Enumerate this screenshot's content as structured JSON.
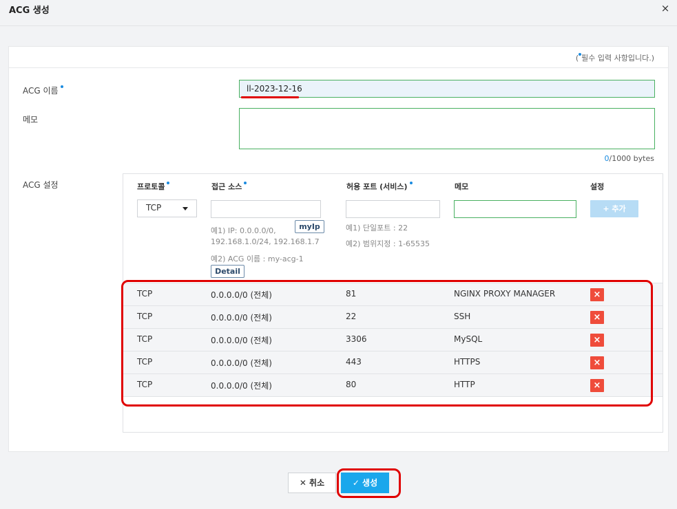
{
  "dialog": {
    "title": "ACG 생성",
    "close_label": "×"
  },
  "form": {
    "required_prefix": "(",
    "required_suffix": "필수 입력 사항입니다.)",
    "name_label": "ACG 이름",
    "name_value": "ll-2023-12-16",
    "memo_label": "메모",
    "memo_value": "",
    "byte_count": "0",
    "byte_limit": "/1000 bytes",
    "acg_setting_label": "ACG 설정"
  },
  "acg_table": {
    "headers": {
      "protocol": "프로토콜",
      "source": "접근 소스",
      "port": "허용 포트 (서비스)",
      "memo": "메모",
      "setting": "설정"
    },
    "protocol_selected": "TCP",
    "add_label": "+ 추가",
    "source_hint_1": "예1) IP: 0.0.0.0/0,",
    "source_hint_2": "192.168.1.0/24, 192.168.1.7",
    "source_hint_3": "예2) ACG 이름 : my-acg-1",
    "myip_label": "myIp",
    "detail_label": "Detail",
    "port_hint_1": "예1) 단일포트 : 22",
    "port_hint_2": "예2) 범위지정 : 1-65535",
    "delete_icon": "×",
    "rules": [
      {
        "protocol": "TCP",
        "source": "0.0.0.0/0 (전체)",
        "port": "81",
        "memo": "NGINX PROXY MANAGER"
      },
      {
        "protocol": "TCP",
        "source": "0.0.0.0/0 (전체)",
        "port": "22",
        "memo": "SSH"
      },
      {
        "protocol": "TCP",
        "source": "0.0.0.0/0 (전체)",
        "port": "3306",
        "memo": "MySQL"
      },
      {
        "protocol": "TCP",
        "source": "0.0.0.0/0 (전체)",
        "port": "443",
        "memo": "HTTPS"
      },
      {
        "protocol": "TCP",
        "source": "0.0.0.0/0 (전체)",
        "port": "80",
        "memo": "HTTP"
      }
    ]
  },
  "footer": {
    "cancel_label": "✕ 취소",
    "create_label": "✓ 생성"
  },
  "colors": {
    "accent": "#1aa7ec",
    "required_dot": "#1a8be0",
    "delete": "#ef4c3b",
    "annotation": "#e00000"
  }
}
